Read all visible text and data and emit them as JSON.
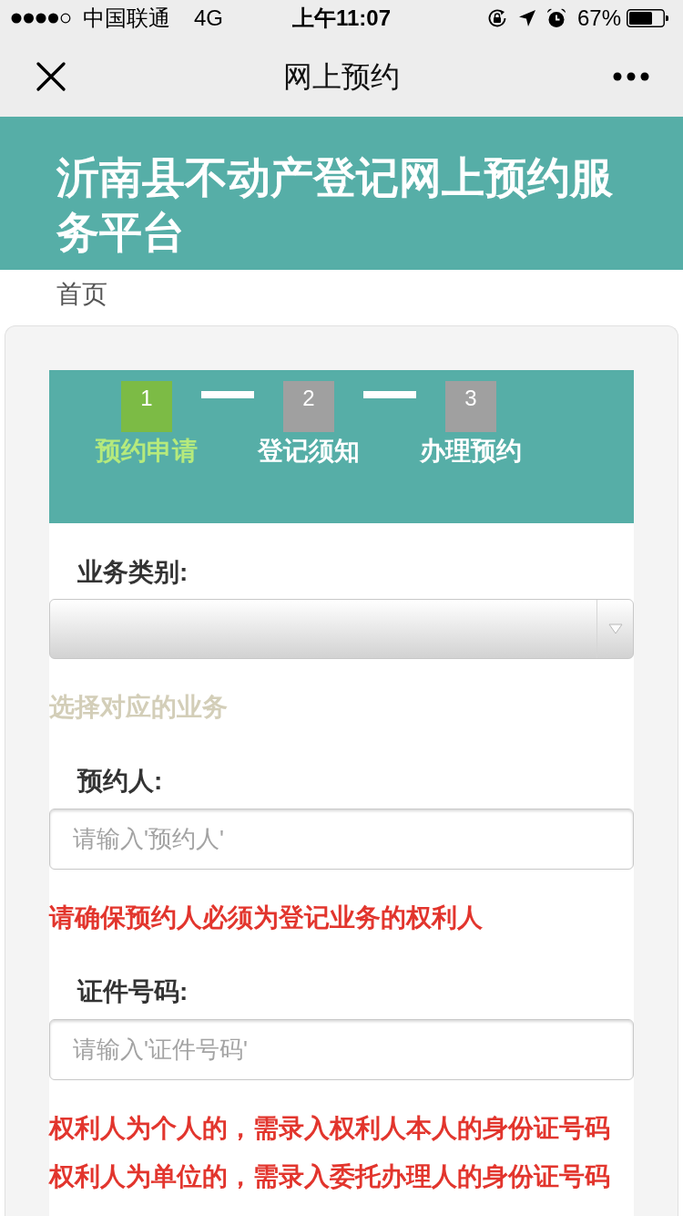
{
  "status_bar": {
    "carrier": "中国联通",
    "network": "4G",
    "time": "上午11:07",
    "battery": "67%"
  },
  "nav_bar": {
    "title": "网上预约"
  },
  "header": {
    "title": "沂南县不动产登记网上预约服务平台"
  },
  "breadcrumb": "首页",
  "steps": [
    {
      "number": "1",
      "label": "预约申请",
      "selected": true
    },
    {
      "number": "2",
      "label": "登记须知",
      "selected": false
    },
    {
      "number": "3",
      "label": "办理预约",
      "selected": false
    }
  ],
  "form": {
    "fields": [
      {
        "kind": "select",
        "label": "业务类别:",
        "notes": [
          {
            "kind": "hint",
            "text": "选择对应的业务"
          }
        ]
      },
      {
        "kind": "input",
        "label": "预约人:",
        "placeholder": "请输入'预约人'",
        "notes": [
          {
            "kind": "warning",
            "text": "请确保预约人必须为登记业务的权利人"
          }
        ]
      },
      {
        "kind": "input",
        "label": "证件号码:",
        "placeholder": "请输入'证件号码'",
        "notes": [
          {
            "kind": "warning",
            "text": "权利人为个人的，需录入权利人本人的身份证号码"
          },
          {
            "kind": "warning",
            "text": "权利人为单位的，需录入委托办理人的身份证号码"
          }
        ]
      }
    ]
  }
}
